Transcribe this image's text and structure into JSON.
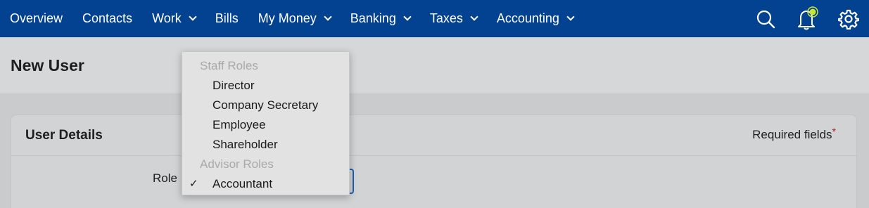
{
  "nav": {
    "items": [
      {
        "label": "Overview",
        "has_menu": false
      },
      {
        "label": "Contacts",
        "has_menu": false
      },
      {
        "label": "Work",
        "has_menu": true
      },
      {
        "label": "Bills",
        "has_menu": false
      },
      {
        "label": "My Money",
        "has_menu": true
      },
      {
        "label": "Banking",
        "has_menu": true
      },
      {
        "label": "Taxes",
        "has_menu": true
      },
      {
        "label": "Accounting",
        "has_menu": true
      }
    ],
    "icons": [
      "search-icon",
      "notifications-bell-icon",
      "settings-gear-icon"
    ],
    "bg_color": "#034191",
    "notification_dot_color": "#c8e632"
  },
  "page": {
    "title": "New User"
  },
  "user_details": {
    "title": "User Details",
    "required_text": "Required fields",
    "required_marker": "*",
    "role_label": "Role"
  },
  "role_dropdown": {
    "groups": [
      {
        "label": "Staff Roles",
        "options": [
          {
            "label": "Director",
            "selected": false
          },
          {
            "label": "Company Secretary",
            "selected": false
          },
          {
            "label": "Employee",
            "selected": false
          },
          {
            "label": "Shareholder",
            "selected": false
          }
        ]
      },
      {
        "label": "Advisor Roles",
        "options": [
          {
            "label": "Accountant",
            "selected": true
          }
        ]
      }
    ],
    "check_glyph": "✓"
  }
}
